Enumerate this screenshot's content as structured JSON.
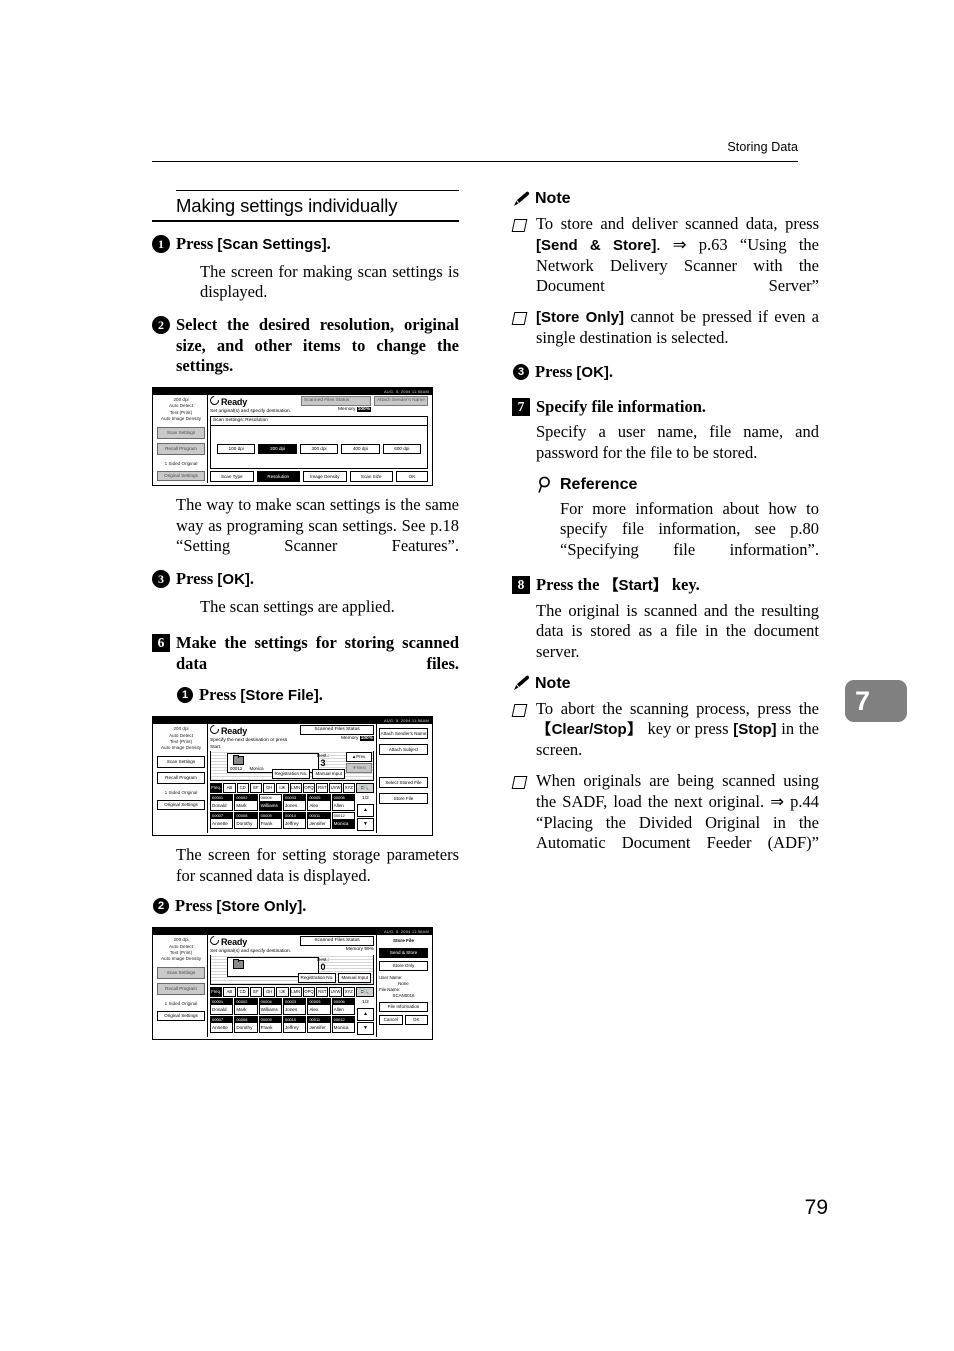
{
  "page": {
    "running_head": "Storing Data",
    "folio": "79",
    "chapter_tab": "7"
  },
  "left_column": {
    "section_title": "Making settings individually",
    "steps": [
      {
        "marker": "1",
        "title_pre": "Press ",
        "title_ui": "[Scan Settings]",
        "title_post": ".",
        "body": "The screen for making scan settings is displayed."
      },
      {
        "marker": "2",
        "title": "Select the desired resolution, original size, and other items to change the settings.",
        "body": "The way to make scan settings is the same way as programing scan settings. See p.18 “Setting Scanner Features”."
      },
      {
        "marker": "3",
        "title_pre": "Press ",
        "title_ui": "[OK]",
        "title_post": ".",
        "body": "The scan settings are applied."
      }
    ],
    "step6": {
      "marker": "6",
      "title": "Make the settings for storing scanned data files.",
      "sub1": {
        "marker": "1",
        "pre": "Press ",
        "ui": "[Store File]",
        "post": ".",
        "body": "The screen for setting storage parameters for scanned data is displayed."
      },
      "sub2": {
        "marker": "2",
        "pre": "Press ",
        "ui": "[Store Only]",
        "post": "."
      }
    }
  },
  "right_column": {
    "note1": {
      "heading": "Note",
      "icon": "pencil-icon",
      "items": [
        {
          "pre": "To store and deliver scanned data, press ",
          "ui": "[Send & Store]",
          "post": ". ⇒ p.63 “Using the Network Delivery Scanner with the Document Server”"
        },
        {
          "ui": "[Store Only]",
          "post": " cannot be pressed if even a single destination is selected."
        }
      ]
    },
    "sub3": {
      "marker": "3",
      "pre": "Press ",
      "ui": "[OK]",
      "post": "."
    },
    "step7": {
      "marker": "7",
      "title": "Specify file information.",
      "body": "Specify a user name, file name, and password for the file to be stored."
    },
    "reference": {
      "heading": "Reference",
      "icon": "magnifier-icon",
      "body": "For more information about how to specify file information, see p.80 “Specifying file information”."
    },
    "step8": {
      "marker": "8",
      "title_pre": "Press the ",
      "title_key": "【Start】",
      "title_post": " key.",
      "body": "The original is scanned and the resulting data is stored as a file in the document server."
    },
    "note2": {
      "heading": "Note",
      "icon": "pencil-icon",
      "items": [
        {
          "pre": "To abort the scanning process, press the ",
          "key": "【Clear/Stop】",
          "mid": " key or press ",
          "ui": "[Stop]",
          "post": " in the screen."
        },
        {
          "pre": "When originals are being scanned using the SADF, load the next original. ⇒ p.44 “Placing the Divided Original in the Automatic Document Feeder (ADF)”"
        }
      ]
    }
  },
  "lcd_common": {
    "status": "Ready",
    "top_tiny": "AUG.   5, 2004  11:58AM",
    "memory_label": "Memory",
    "side_stats": [
      "200 dpi",
      "Auto Detect",
      "Text (Print)",
      "Auto Image Density"
    ],
    "side_buttons": [
      "Scan Settings",
      "Recall Program"
    ],
    "side_original_label": "1 Sided Original",
    "side_original_button": "Original Settings"
  },
  "lcd1": {
    "subline": "Set original(s) and specify destination.",
    "scanned_files_status": "Scanned Files Status",
    "attach_sender": "Attach Sender's Name",
    "memory_value": "100%",
    "field_title": "Scan Settings: Resolution",
    "resolutions": [
      "100 dpi",
      "200 dpi",
      "300 dpi",
      "400 dpi",
      "600 dpi"
    ],
    "resolution_selected": "200 dpi",
    "tabs": [
      "Scan Type",
      "Resolution",
      "Image Density",
      "Scan Size"
    ],
    "tab_selected": "Resolution",
    "ok": "OK"
  },
  "lcd2": {
    "subline": "Specify the next destination or press Start.",
    "scanned_files_status": "Scanned Files Status",
    "memory_value": "100%",
    "dest_card_code": "00012",
    "dest_card_name": "Monica",
    "dest_label": "Dest.:",
    "dest_count": "3",
    "prev": "Prev.",
    "next": "Next",
    "registration_no": "Registration No.",
    "manual_input": "Manual Input",
    "alpha_tabs": [
      "Freq.",
      "AB",
      "CD",
      "EF",
      "GH",
      "IJK",
      "LMN",
      "OPQ",
      "RST",
      "UVW",
      "XYZ"
    ],
    "alpha_selected": "Freq.",
    "search_icon": "search-icon",
    "names": [
      [
        {
          "code": "00001",
          "name": "Donald"
        },
        {
          "code": "00002",
          "name": "Mark"
        },
        {
          "code": "00004",
          "name": "Williams",
          "selected": true
        },
        {
          "code": "00003",
          "name": "Jones"
        },
        {
          "code": "00005",
          "name": "Alex"
        },
        {
          "code": "00006",
          "name": "Allen"
        }
      ],
      [
        {
          "code": "00007",
          "name": "Annette"
        },
        {
          "code": "00008",
          "name": "Dorothy"
        },
        {
          "code": "00009",
          "name": "Frank"
        },
        {
          "code": "00010",
          "name": "Jeffrey"
        },
        {
          "code": "00011",
          "name": "Jennifer"
        },
        {
          "code": "00012",
          "name": "Monica",
          "selected": true
        }
      ]
    ],
    "page_indicator": "1/2",
    "right_buttons": [
      "Attach Sender's Name",
      "Attach Subject",
      "Select Stored File",
      "Store File"
    ]
  },
  "lcd3": {
    "subline": "Set original(s) and specify destination.",
    "scanned_files_status": "Scanned Files Status",
    "memory_value": "99%",
    "dest_label": "Dest.:",
    "dest_count": "0",
    "registration_no": "Registration No.",
    "manual_input": "Manual Input",
    "alpha_tabs": [
      "Freq.",
      "AB",
      "CD",
      "EF",
      "GH",
      "IJK",
      "LMN",
      "OPQ",
      "RST",
      "UVW",
      "XYZ"
    ],
    "alpha_selected": "Freq.",
    "names": [
      [
        {
          "code": "00001",
          "name": "Donald"
        },
        {
          "code": "00002",
          "name": "Mark"
        },
        {
          "code": "00004",
          "name": "Williams"
        },
        {
          "code": "00003",
          "name": "Jones"
        },
        {
          "code": "00005",
          "name": "Alex"
        },
        {
          "code": "00006",
          "name": "Allen"
        }
      ],
      [
        {
          "code": "00007",
          "name": "Annette"
        },
        {
          "code": "00008",
          "name": "Dorothy"
        },
        {
          "code": "00009",
          "name": "Frank"
        },
        {
          "code": "00010",
          "name": "Jeffrey"
        },
        {
          "code": "00011",
          "name": "Jennifer"
        },
        {
          "code": "00012",
          "name": "Monica"
        }
      ]
    ],
    "page_indicator": "1/2",
    "panel_title": "Store File",
    "send_and_store": "Send & Store",
    "store_only": "Store Only",
    "user_name_label": "User Name:",
    "user_name_value": "None",
    "file_name_label": "File Name:",
    "file_name_value": "SCAN0016",
    "file_information": "File Information",
    "cancel": "Cancel",
    "ok": "OK"
  }
}
